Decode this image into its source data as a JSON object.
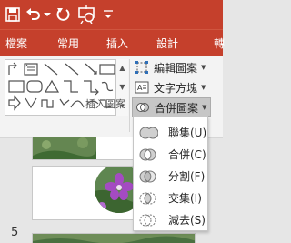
{
  "quick_access": {
    "icons": [
      "save-icon",
      "undo-icon",
      "undo-dropdown-icon",
      "redo-icon",
      "slideshow-icon",
      "customize-dropdown-icon"
    ]
  },
  "tabs": [
    {
      "label": "檔案"
    },
    {
      "label": "常用"
    },
    {
      "label": "插入"
    },
    {
      "label": "設計"
    },
    {
      "label": "轉"
    }
  ],
  "ribbon": {
    "group_label": "插入圖案",
    "edit_shape_label": "編輯圖案",
    "text_box_label": "文字方塊",
    "merge_shapes_label": "合併圖案"
  },
  "merge_menu": {
    "items": [
      {
        "label": "聯集(U)",
        "icon": "union-icon"
      },
      {
        "label": "合併(C)",
        "icon": "combine-icon"
      },
      {
        "label": "分割(F)",
        "icon": "fragment-icon"
      },
      {
        "label": "交集(I)",
        "icon": "intersect-icon"
      },
      {
        "label": "減去(S)",
        "icon": "subtract-icon"
      }
    ]
  },
  "slides": {
    "number": "5"
  },
  "colors": {
    "accent": "#c5402c",
    "ribbon_bg": "#f3f3f3",
    "workspace_bg": "#e6e6e6"
  }
}
